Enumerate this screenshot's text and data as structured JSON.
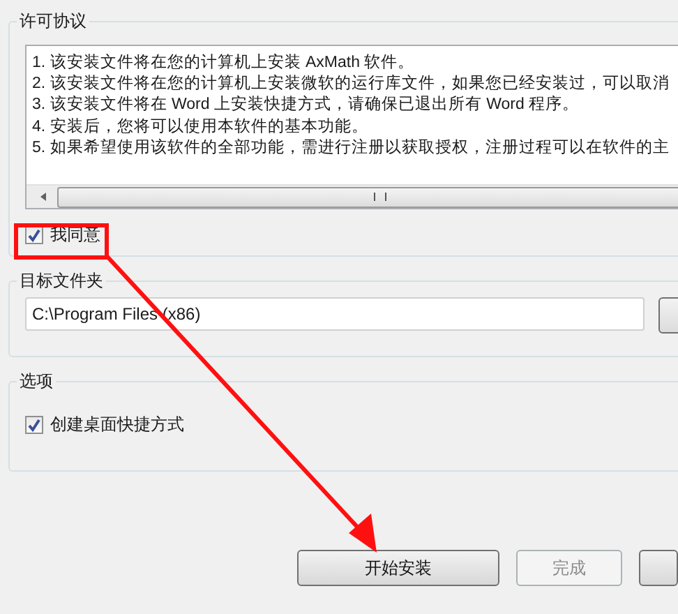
{
  "license": {
    "title": "许可协议",
    "lines": [
      "1. 该安装文件将在您的计算机上安装 AxMath 软件。",
      "2. 该安装文件将在您的计算机上安装微软的运行库文件，如果您已经安装过，可以取消",
      "3. 该安装文件将在 Word 上安装快捷方式，请确保已退出所有 Word 程序。",
      "4. 安装后，您将可以使用本软件的基本功能。",
      "5. 如果希望使用该软件的全部功能，需进行注册以获取授权，注册过程可以在软件的主"
    ]
  },
  "agree": {
    "label": "我同意",
    "checked": true
  },
  "target_folder": {
    "title": "目标文件夹",
    "path": "C:\\Program Files (x86)"
  },
  "options": {
    "title": "选项",
    "items": [
      {
        "label": "创建桌面快捷方式",
        "checked": true
      }
    ]
  },
  "buttons": [
    {
      "label": "开始安装",
      "disabled": false
    },
    {
      "label": "完成",
      "disabled": true
    }
  ]
}
